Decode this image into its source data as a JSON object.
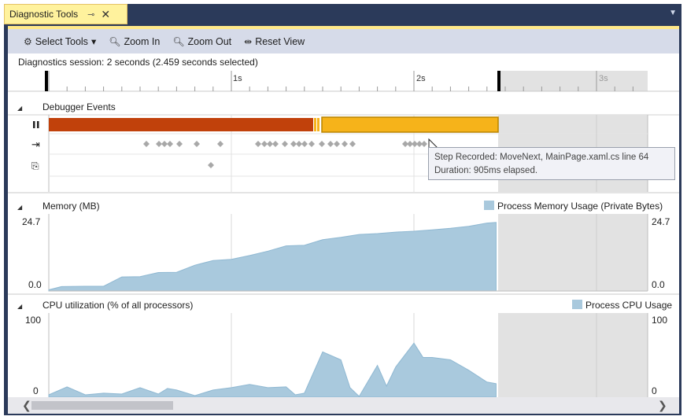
{
  "window": {
    "tab_title": "Diagnostic Tools",
    "pin_glyph": "⊸",
    "close_glyph": "✕",
    "menu_glyph": "▼"
  },
  "toolbar": {
    "select_tools": "Select Tools",
    "select_tools_caret": "▾",
    "zoom_in": "Zoom In",
    "zoom_out": "Zoom Out",
    "reset_view": "Reset View",
    "icons": {
      "select_tools": "gear-icon",
      "zoom_in": "zoom-in-icon",
      "zoom_out": "zoom-out-icon",
      "reset_view": "reset-view-icon"
    }
  },
  "session": {
    "text": "Diagnostics session: 2 seconds (2.459 seconds selected)"
  },
  "ruler": {
    "labels": [
      "1s",
      "2s",
      "3s"
    ]
  },
  "debugger_events": {
    "title": "Debugger Events",
    "collapse_glyph": "◢",
    "row_icons": [
      "pause-icon",
      "step-icon",
      "breakpoint-icon"
    ],
    "colors": {
      "break": "#c1410b",
      "run": "#f6b31a"
    }
  },
  "memory": {
    "title": "Memory (MB)",
    "legend": "Process Memory Usage (Private Bytes)",
    "y_max_label": "24.7",
    "y_min_label": "0.0",
    "color": "#a9c9dd"
  },
  "cpu": {
    "title": "CPU utilization (% of all processors)",
    "legend": "Process CPU Usage",
    "y_max_label": "100",
    "y_min_label": "0",
    "color": "#a9c9dd"
  },
  "tooltip": {
    "line1": "Step Recorded: MoveNext, MainPage.xaml.cs line 64",
    "line2": "Duration:  905ms elapsed."
  },
  "scrollbar": {
    "left_glyph": "❮",
    "right_glyph": "❯"
  },
  "chart_data": [
    {
      "type": "area",
      "title": "Memory (MB)",
      "x": [
        0.0,
        0.07,
        0.2,
        0.3,
        0.4,
        0.5,
        0.6,
        0.7,
        0.8,
        0.9,
        1.0,
        1.1,
        1.2,
        1.3,
        1.4,
        1.5,
        1.6,
        1.7,
        1.8,
        1.9,
        2.0,
        2.1,
        2.2,
        2.3,
        2.4,
        2.45
      ],
      "series": [
        {
          "name": "Process Memory Usage (Private Bytes)",
          "values": [
            0.4,
            1.5,
            1.6,
            1.6,
            4.8,
            4.9,
            6.3,
            6.4,
            8.8,
            10.4,
            10.8,
            12.1,
            13.6,
            15.4,
            15.6,
            17.5,
            18.3,
            19.3,
            19.6,
            20.1,
            20.4,
            20.9,
            21.4,
            22.1,
            23.2,
            23.4
          ]
        }
      ],
      "ylim": [
        0,
        24.7
      ]
    },
    {
      "type": "area",
      "title": "CPU utilization (% of all processors)",
      "x": [
        0.0,
        0.1,
        0.2,
        0.3,
        0.4,
        0.5,
        0.6,
        0.65,
        0.7,
        0.8,
        0.9,
        1.0,
        1.1,
        1.2,
        1.3,
        1.35,
        1.4,
        1.5,
        1.6,
        1.65,
        1.7,
        1.8,
        1.85,
        1.9,
        2.0,
        2.05,
        2.1,
        2.2,
        2.3,
        2.4,
        2.45
      ],
      "series": [
        {
          "name": "Process CPU Usage",
          "values": [
            3,
            13,
            3,
            5,
            4,
            12,
            4,
            11,
            9,
            2,
            9,
            12,
            16,
            12,
            13,
            3,
            5,
            57,
            47,
            12,
            1,
            40,
            14,
            38,
            68,
            50,
            50,
            47,
            34,
            19,
            17
          ]
        }
      ],
      "ylim": [
        0,
        100
      ]
    }
  ]
}
